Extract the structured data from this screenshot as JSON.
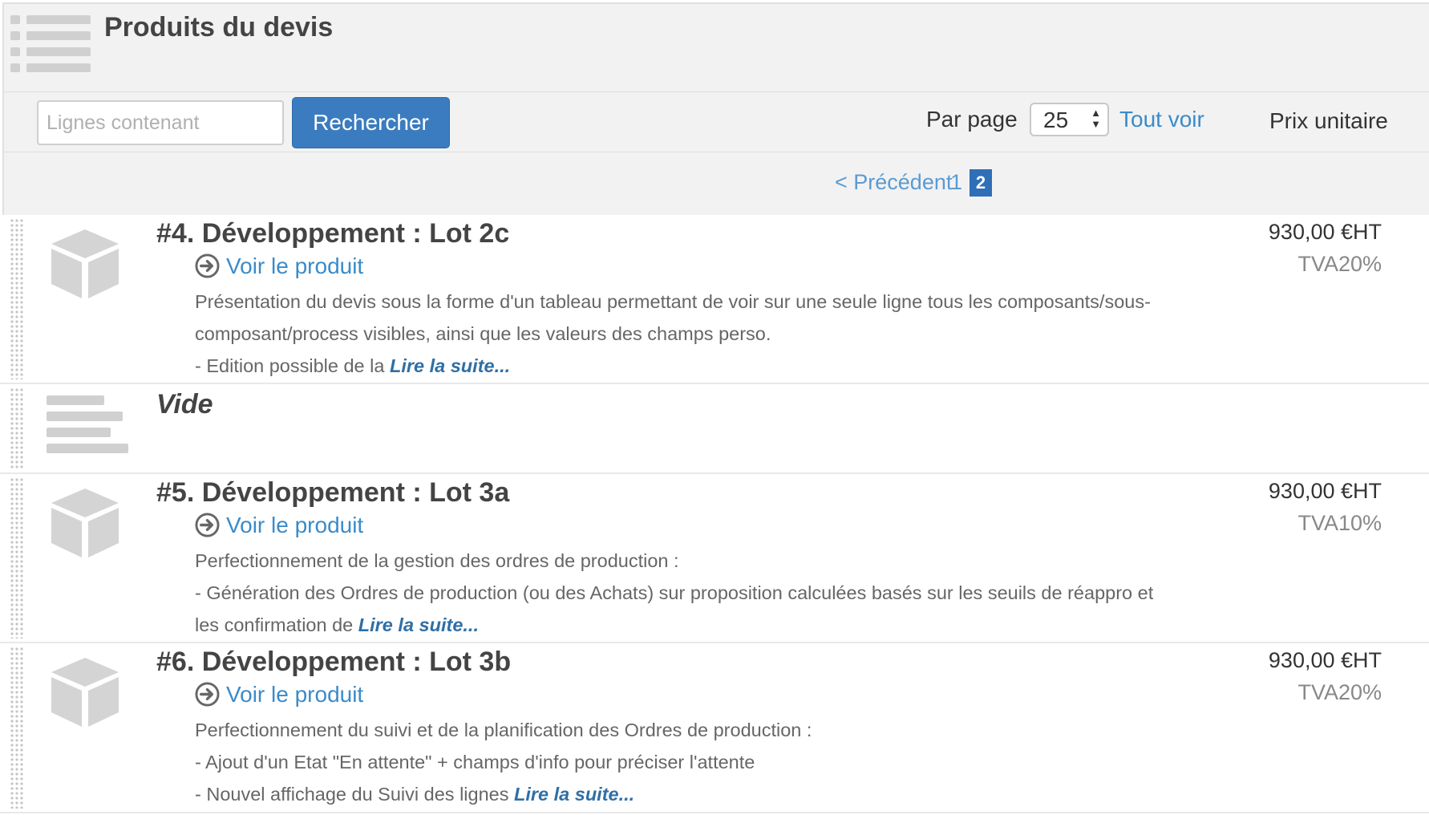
{
  "header": {
    "title": "Produits du devis"
  },
  "toolbar": {
    "search_placeholder": "Lignes contenant",
    "search_button": "Rechercher",
    "per_page_label": "Par page",
    "per_page_value": "25",
    "view_all": "Tout voir",
    "unit_price_header": "Prix unitaire"
  },
  "pagination": {
    "previous": "< Précédent",
    "pages": [
      "1",
      "2"
    ],
    "current_page": "2"
  },
  "rows": [
    {
      "title": "#4. Développement : Lot 2c",
      "view_link": "Voir le produit",
      "description": [
        "Présentation du devis sous la forme d'un tableau permettant de voir sur une seule ligne tous les composants/sous-",
        "composant/process visibles, ainsi que les valeurs des champs perso.",
        "- Edition possible de la"
      ],
      "read_more": "Lire la suite...",
      "price": "930,00 €HT",
      "tva": "TVA20%"
    },
    {
      "title": "Vide"
    },
    {
      "title": "#5. Développement : Lot 3a",
      "view_link": "Voir le produit",
      "description": [
        "Perfectionnement de la gestion des ordres de production :",
        "- Génération des Ordres de production (ou des Achats) sur proposition calculées basés sur les seuils de réappro et",
        "les confirmation de"
      ],
      "read_more": "Lire la suite...",
      "price": "930,00 €HT",
      "tva": "TVA10%"
    },
    {
      "title": "#6. Développement : Lot 3b",
      "view_link": "Voir le produit",
      "description": [
        "Perfectionnement du suivi et de la planification des Ordres de production :",
        "- Ajout d'un Etat \"En attente\" + champs d'info pour préciser l'attente",
        "- Nouvel affichage du Suivi des lignes"
      ],
      "read_more": "Lire la suite...",
      "price": "930,00 €HT",
      "tva": "TVA20%"
    }
  ],
  "colors": {
    "accent": "#3a7cbf",
    "link": "#3a8bc9",
    "header_bg": "#f2f2f2",
    "icon_gray": "#d0d0d0"
  },
  "icons": {
    "header": "list-icon",
    "product": "box-icon",
    "empty_line": "text-lines-icon",
    "view": "arrow-circle-right-icon",
    "drag": "drag-handle-icon"
  }
}
